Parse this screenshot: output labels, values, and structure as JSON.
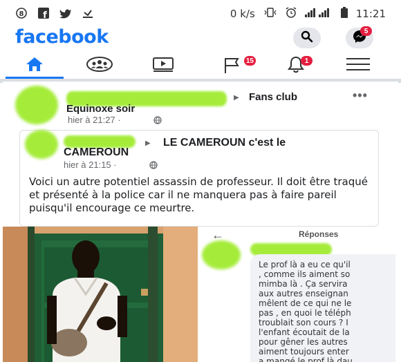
{
  "status_bar": {
    "left_icons": [
      "headset-icon",
      "facebook-icon",
      "twitter-icon",
      "download-icon"
    ],
    "speed": "0 k/s",
    "time": "11:21"
  },
  "header": {
    "logo": "facebook",
    "messenger_badge": "5"
  },
  "nav": {
    "items": [
      {
        "name": "home-icon",
        "active": true
      },
      {
        "name": "groups-icon",
        "active": false
      },
      {
        "name": "watch-icon",
        "active": false
      },
      {
        "name": "pages-icon",
        "badge": "15",
        "active": false
      },
      {
        "name": "notifications-icon",
        "badge": "1",
        "active": false
      },
      {
        "name": "menu-icon",
        "active": false
      }
    ],
    "pages_badge": "15",
    "notifications_badge": "1"
  },
  "post": {
    "group": "Fans club",
    "group_line2": "Equinoxe soir",
    "time": "hier à 21:27 ·",
    "shared": {
      "group": "LE CAMEROUN c'est le",
      "group_line2": "CAMEROUN",
      "time": "hier à 21:15 ·",
      "text": "Voici un autre potentiel assassin de professeur. Il doit être traqué et présenté à la police car il ne manquera pas à faire pareil puisqu'il encourage ce meurtre."
    }
  },
  "replies": {
    "title": "Réponses",
    "lines": [
      "Le prof là a eu ce qu'il",
      ", comme ils aiment so",
      "mimba là . Ça servira",
      "aux autres  enseignan",
      "mêlent de ce qui ne le",
      "pas , en quoi le téléph",
      "troublait son cours ? I",
      "l'enfant écoutait de la",
      "pour gêner les autres",
      "aiment toujours enter",
      "a mangé le prof là dau"
    ]
  },
  "colors": {
    "brand": "#1877f2",
    "badge": "#e41e3f",
    "redaction": "#a5ec3a"
  }
}
